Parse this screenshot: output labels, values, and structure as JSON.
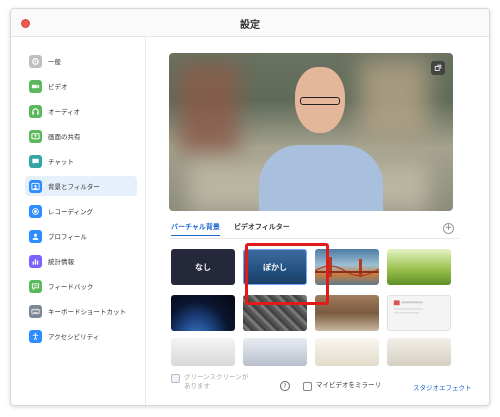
{
  "window": {
    "title": "設定"
  },
  "sidebar": {
    "items": [
      {
        "label": "一般",
        "icon": "gear-icon",
        "color": "#bfbfbf",
        "active": false
      },
      {
        "label": "ビデオ",
        "icon": "video-icon",
        "color": "#5cb85c",
        "active": false
      },
      {
        "label": "オーディオ",
        "icon": "headphones-icon",
        "color": "#5cb85c",
        "active": false
      },
      {
        "label": "画面の共有",
        "icon": "share-screen-icon",
        "color": "#5cb85c",
        "active": false
      },
      {
        "label": "チャット",
        "icon": "chat-icon",
        "color": "#33a6a6",
        "active": false
      },
      {
        "label": "背景とフィルター",
        "icon": "background-icon",
        "color": "#2d8cff",
        "active": true
      },
      {
        "label": "レコーディング",
        "icon": "record-icon",
        "color": "#2d8cff",
        "active": false
      },
      {
        "label": "プロフィール",
        "icon": "profile-icon",
        "color": "#2d8cff",
        "active": false
      },
      {
        "label": "統計情報",
        "icon": "stats-icon",
        "color": "#7b61ff",
        "active": false
      },
      {
        "label": "フィードバック",
        "icon": "feedback-icon",
        "color": "#5cb85c",
        "active": false
      },
      {
        "label": "キーボードショートカット",
        "icon": "keyboard-icon",
        "color": "#7b8794",
        "active": false
      },
      {
        "label": "アクセシビリティ",
        "icon": "accessibility-icon",
        "color": "#2d8cff",
        "active": false
      }
    ]
  },
  "tabs": [
    {
      "label": "バーチャル背景",
      "active": true
    },
    {
      "label": "ビデオフィルター",
      "active": false
    }
  ],
  "backgrounds": {
    "none_label": "なし",
    "blur_label": "ぼかし",
    "items": [
      {
        "name": "none"
      },
      {
        "name": "blur"
      },
      {
        "name": "golden-gate-bridge"
      },
      {
        "name": "grass"
      },
      {
        "name": "earth-from-space"
      },
      {
        "name": "stone-texture"
      },
      {
        "name": "brick-room"
      },
      {
        "name": "document-desk"
      },
      {
        "name": "white-office"
      },
      {
        "name": "office-blur"
      },
      {
        "name": "bright-room"
      },
      {
        "name": "coffee-table"
      }
    ]
  },
  "footer": {
    "greenscreen_label": "グリーンスクリーンがあります",
    "mirror_label": "マイビデオをミラーリ",
    "studio_effects_label": "スタジオエフェクト",
    "help_glyph": "?"
  },
  "preview": {
    "button_icon": "pin-icon"
  },
  "colors": {
    "accent": "#1a66d1",
    "highlight": "#e21a1a"
  }
}
